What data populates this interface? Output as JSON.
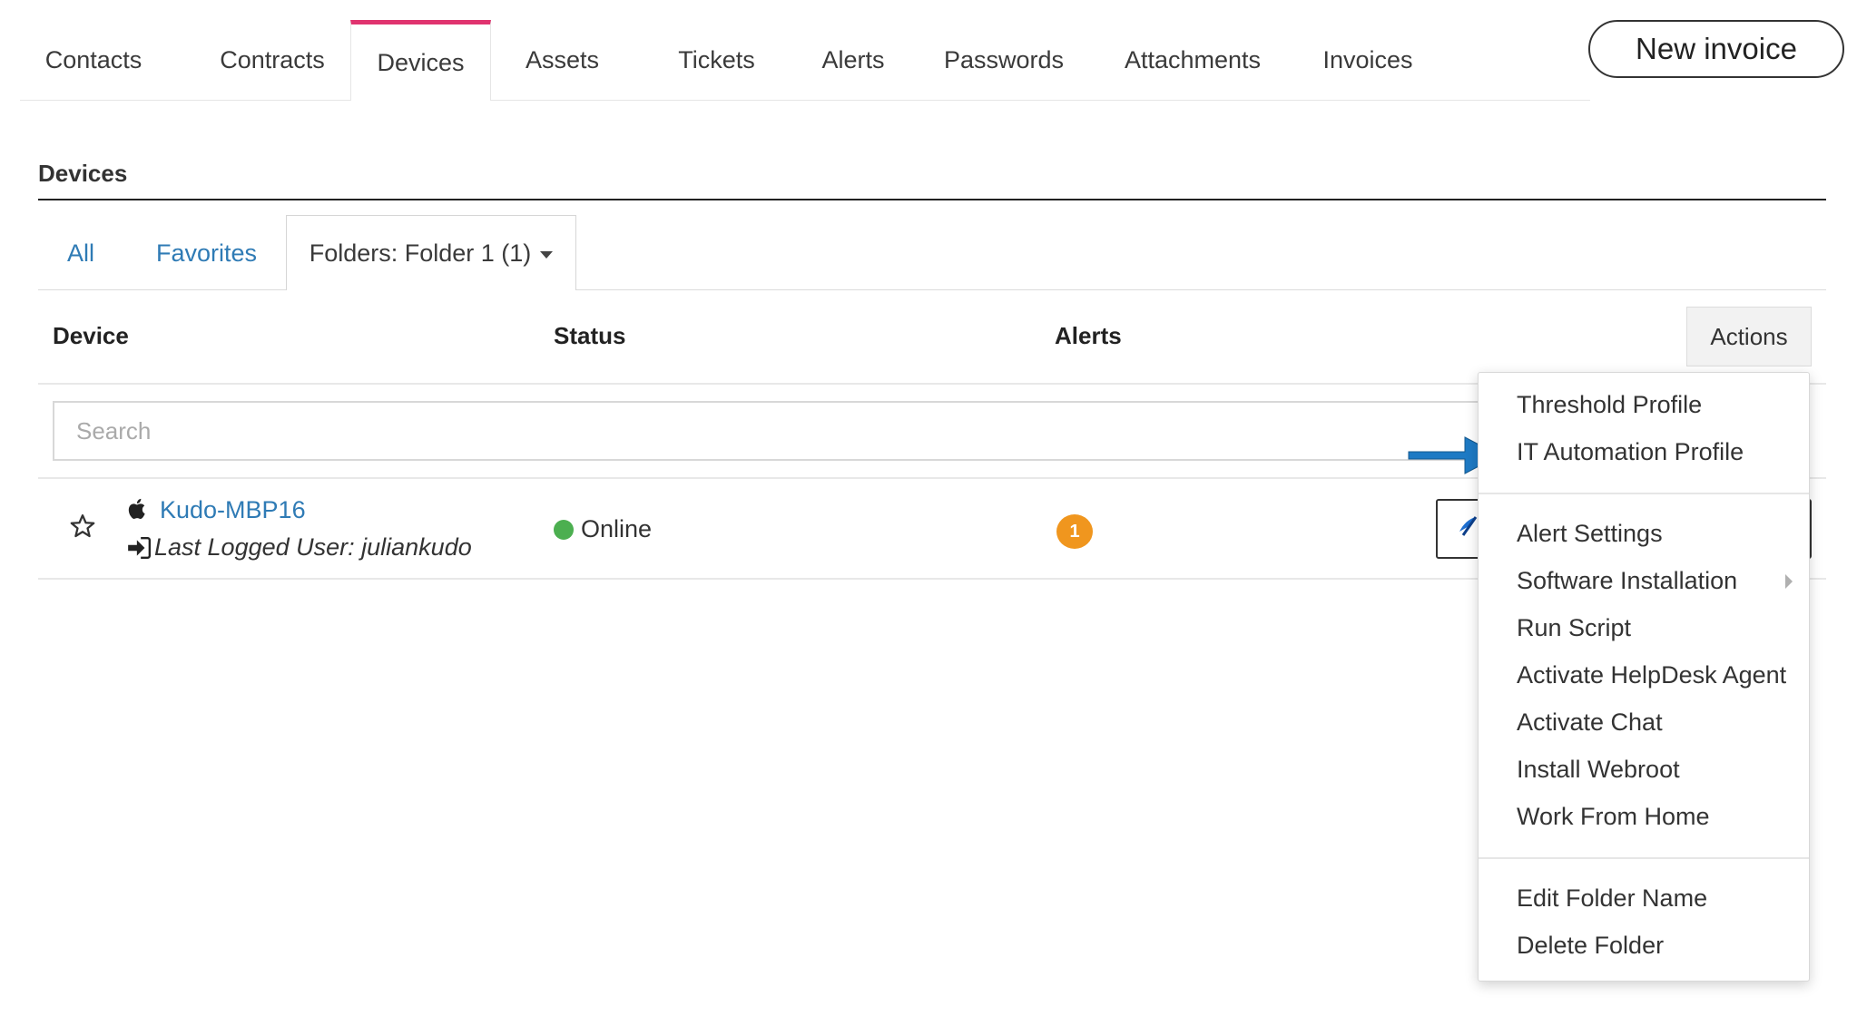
{
  "tabs": [
    {
      "label": "Contacts"
    },
    {
      "label": "Contracts"
    },
    {
      "label": "Devices",
      "active": true
    },
    {
      "label": "Assets"
    },
    {
      "label": "Tickets"
    },
    {
      "label": "Alerts"
    },
    {
      "label": "Passwords"
    },
    {
      "label": "Attachments"
    },
    {
      "label": "Invoices"
    }
  ],
  "new_invoice_label": "New invoice",
  "section": {
    "title": "Devices"
  },
  "subtabs": {
    "all": "All",
    "favorites": "Favorites",
    "folder": "Folders: Folder 1 (1)"
  },
  "table": {
    "headers": {
      "device": "Device",
      "status": "Status",
      "alerts": "Alerts"
    },
    "actions_label": "Actions",
    "search_placeholder": "Search",
    "rows": [
      {
        "device_name": "Kudo-MBP16",
        "last_user": "Last Logged User: juliankudo",
        "status": "Online",
        "alerts_count": "1"
      }
    ]
  },
  "actions_menu": {
    "group1": [
      "Threshold Profile",
      "IT Automation Profile"
    ],
    "group2": [
      "Alert Settings",
      "Software Installation",
      "Run Script",
      "Activate HelpDesk Agent",
      "Activate Chat",
      "Install Webroot",
      "Work From Home"
    ],
    "group3": [
      "Edit Folder Name",
      "Delete Folder"
    ]
  },
  "colors": {
    "accent_tab": "#e0336f",
    "link": "#2f7bb5",
    "online": "#4caf50",
    "alert_badge": "#f0961e",
    "callout_arrow": "#1e7ac4"
  }
}
